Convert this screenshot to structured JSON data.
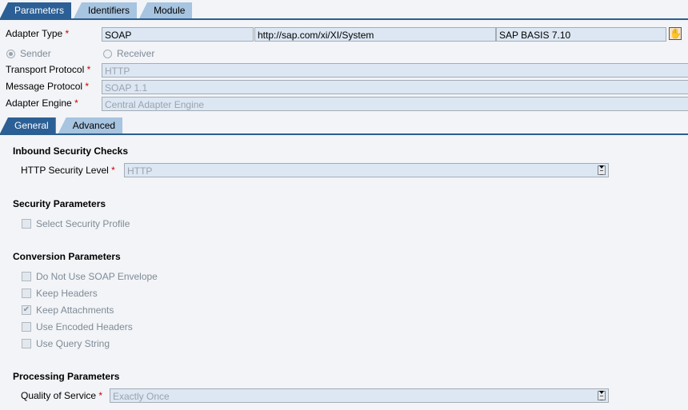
{
  "top_tabs": [
    {
      "label": "Parameters",
      "active": true
    },
    {
      "label": "Identifiers",
      "active": false
    },
    {
      "label": "Module",
      "active": false
    }
  ],
  "adapter_type": {
    "label": "Adapter Type",
    "required_mark": "*",
    "name": "SOAP",
    "namespace": "http://sap.com/xi/XI/System",
    "software_component": "SAP BASIS 7.10",
    "browse_icon": "hand-pointer-icon"
  },
  "direction": {
    "options": [
      {
        "label": "Sender",
        "selected": true
      },
      {
        "label": "Receiver",
        "selected": false
      }
    ]
  },
  "transport_protocol": {
    "label": "Transport Protocol",
    "required_mark": "*",
    "value": "HTTP"
  },
  "message_protocol": {
    "label": "Message Protocol",
    "required_mark": "*",
    "value": "SOAP 1.1"
  },
  "adapter_engine": {
    "label": "Adapter Engine",
    "required_mark": "*",
    "value": "Central Adapter Engine"
  },
  "sub_tabs": [
    {
      "label": "General",
      "active": true
    },
    {
      "label": "Advanced",
      "active": false
    }
  ],
  "inbound_security": {
    "title": "Inbound Security Checks",
    "http_security_level": {
      "label": "HTTP Security Level",
      "required_mark": "*",
      "value": "HTTP"
    }
  },
  "security_parameters": {
    "title": "Security Parameters",
    "checkboxes": [
      {
        "label": "Select Security Profile",
        "checked": false
      }
    ]
  },
  "conversion_parameters": {
    "title": "Conversion Parameters",
    "checkboxes": [
      {
        "label": "Do Not Use SOAP Envelope",
        "checked": false
      },
      {
        "label": "Keep Headers",
        "checked": false
      },
      {
        "label": "Keep Attachments",
        "checked": true
      },
      {
        "label": "Use Encoded Headers",
        "checked": false
      },
      {
        "label": "Use Query String",
        "checked": false
      }
    ]
  },
  "processing_parameters": {
    "title": "Processing Parameters",
    "quality_of_service": {
      "label": "Quality of Service",
      "required_mark": "*",
      "value": "Exactly Once"
    }
  },
  "check_glyph": "✔"
}
